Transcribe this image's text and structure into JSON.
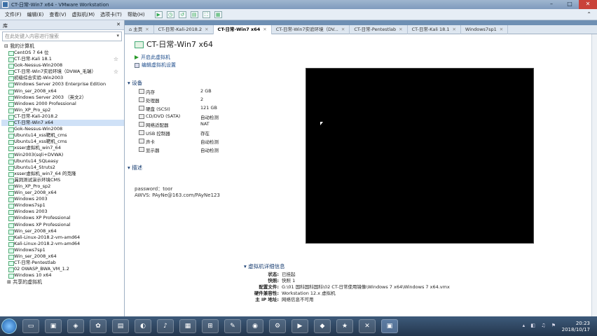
{
  "window": {
    "title": "CT-日常-Win7 x64 - VMware Workstation"
  },
  "menu": [
    "文件(F)",
    "编辑(E)",
    "查看(V)",
    "虚拟机(M)",
    "选项卡(T)",
    "帮助(H)"
  ],
  "library": {
    "title": "库",
    "search_placeholder": "在此处键入内容进行搜索",
    "root": "我的计算机",
    "shared": "共享的虚拟机",
    "vms": [
      "CentOS 7 64 位",
      "CT-日常-Kali 18.1",
      "Gok-Nessus-Win2008",
      "CT-日常-Win7实验环境（DVWA_毛瑞）",
      "初级综合实验-Win2003",
      "Windows Server 2003 Enterprise Edition",
      "Win_ser_2008_x64",
      "Windows Server 2003 （英文2）",
      "Windows 2000 Professional",
      "Win_XP_Pro_sp2",
      "CT-日常-Kali-2018.2",
      "CT-日常-Win7 x64",
      "Gok-Nessus-Win2008",
      "Ubuntu14_xss靶机_cms",
      "Ubuntu14_xss靶机_cms",
      "xsser虚拟机_win7_64",
      "Win2003(sqli+DVWA)",
      "Ubuntu14_SQLeasy",
      "Ubuntu14_Struts2",
      "xsser虚拟机_win7_64 的克隆",
      "漏洞测试演示环境CMS",
      "Win_XP_Pro_sp2",
      "Win_ser_2008_x64",
      "Windows 2003",
      "Windows7sp1",
      "Windows 2003",
      "Windows XP Professional",
      "Windows XP Professional",
      "Win_ser_2008_x64",
      "Kali-Linux-2018.2-vm-amd64",
      "Kali-Linux-2018.2-vm-amd64",
      "Windows7sp1",
      "Win_ser_2008_x64",
      "CT-日常-Pentestlab",
      "02 OWASP_BWA_VM_1.2",
      "Windows 10 x64"
    ]
  },
  "tabs": [
    "主页",
    "CT-日常-Kali-2018.2",
    "CT-日常-Win7 x64",
    "CT-日常-Win7实验环境（DV...",
    "CT-日常-Pentestlab",
    "CT-日常-Kali 18.1",
    "Windows7sp1"
  ],
  "vm": {
    "name": "CT-日常-Win7 x64",
    "actions": [
      "开启此虚拟机",
      "编辑虚拟机设置"
    ],
    "devices_header": "设备",
    "devices": [
      {
        "name": "内存",
        "value": "2 GB"
      },
      {
        "name": "处理器",
        "value": "2"
      },
      {
        "name": "硬盘 (SCSI)",
        "value": "121 GB"
      },
      {
        "name": "CD/DVD (SATA)",
        "value": "自动检测"
      },
      {
        "name": "网络适配器",
        "value": "NAT"
      },
      {
        "name": "USB 控制器",
        "value": "存在"
      },
      {
        "name": "声卡",
        "value": "自动检测"
      },
      {
        "name": "显示器",
        "value": "自动检测"
      }
    ],
    "description_header": "描述",
    "description_lines": [
      "password：toor",
      "AWVS: PAyNe@163.com/PAyNe123"
    ],
    "details_header": "虚拟机详细信息",
    "details": [
      {
        "key": "状态:",
        "value": "已挂起"
      },
      {
        "key": "快照:",
        "value": "快照 1"
      },
      {
        "key": "配置文件:",
        "value": "G:\\01 国科国科国科\\02 CT-日常使用镜像\\Windows 7 x64\\Windows 7 x64.vmx"
      },
      {
        "key": "硬件兼容性:",
        "value": "Workstation 12.x 虚拟机"
      },
      {
        "key": "主 IP 地址:",
        "value": "网络信息不可用"
      }
    ]
  },
  "taskbar": {
    "time": "20:23",
    "date": "2018/10/17"
  }
}
